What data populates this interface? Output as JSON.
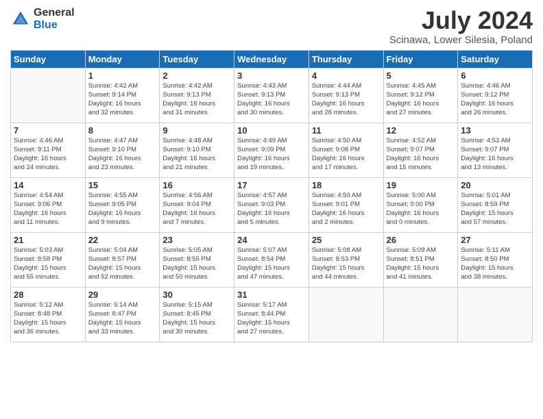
{
  "logo": {
    "general": "General",
    "blue": "Blue"
  },
  "title": "July 2024",
  "subtitle": "Scinawa, Lower Silesia, Poland",
  "days_of_week": [
    "Sunday",
    "Monday",
    "Tuesday",
    "Wednesday",
    "Thursday",
    "Friday",
    "Saturday"
  ],
  "weeks": [
    [
      {
        "day": "",
        "info": ""
      },
      {
        "day": "1",
        "info": "Sunrise: 4:42 AM\nSunset: 9:14 PM\nDaylight: 16 hours\nand 32 minutes."
      },
      {
        "day": "2",
        "info": "Sunrise: 4:42 AM\nSunset: 9:13 PM\nDaylight: 16 hours\nand 31 minutes."
      },
      {
        "day": "3",
        "info": "Sunrise: 4:43 AM\nSunset: 9:13 PM\nDaylight: 16 hours\nand 30 minutes."
      },
      {
        "day": "4",
        "info": "Sunrise: 4:44 AM\nSunset: 9:13 PM\nDaylight: 16 hours\nand 28 minutes."
      },
      {
        "day": "5",
        "info": "Sunrise: 4:45 AM\nSunset: 9:12 PM\nDaylight: 16 hours\nand 27 minutes."
      },
      {
        "day": "6",
        "info": "Sunrise: 4:46 AM\nSunset: 9:12 PM\nDaylight: 16 hours\nand 26 minutes."
      }
    ],
    [
      {
        "day": "7",
        "info": "Sunrise: 4:46 AM\nSunset: 9:11 PM\nDaylight: 16 hours\nand 24 minutes."
      },
      {
        "day": "8",
        "info": "Sunrise: 4:47 AM\nSunset: 9:10 PM\nDaylight: 16 hours\nand 23 minutes."
      },
      {
        "day": "9",
        "info": "Sunrise: 4:48 AM\nSunset: 9:10 PM\nDaylight: 16 hours\nand 21 minutes."
      },
      {
        "day": "10",
        "info": "Sunrise: 4:49 AM\nSunset: 9:09 PM\nDaylight: 16 hours\nand 19 minutes."
      },
      {
        "day": "11",
        "info": "Sunrise: 4:50 AM\nSunset: 9:08 PM\nDaylight: 16 hours\nand 17 minutes."
      },
      {
        "day": "12",
        "info": "Sunrise: 4:52 AM\nSunset: 9:07 PM\nDaylight: 16 hours\nand 15 minutes."
      },
      {
        "day": "13",
        "info": "Sunrise: 4:53 AM\nSunset: 9:07 PM\nDaylight: 16 hours\nand 13 minutes."
      }
    ],
    [
      {
        "day": "14",
        "info": "Sunrise: 4:54 AM\nSunset: 9:06 PM\nDaylight: 16 hours\nand 11 minutes."
      },
      {
        "day": "15",
        "info": "Sunrise: 4:55 AM\nSunset: 9:05 PM\nDaylight: 16 hours\nand 9 minutes."
      },
      {
        "day": "16",
        "info": "Sunrise: 4:56 AM\nSunset: 9:04 PM\nDaylight: 16 hours\nand 7 minutes."
      },
      {
        "day": "17",
        "info": "Sunrise: 4:57 AM\nSunset: 9:03 PM\nDaylight: 16 hours\nand 5 minutes."
      },
      {
        "day": "18",
        "info": "Sunrise: 4:59 AM\nSunset: 9:01 PM\nDaylight: 16 hours\nand 2 minutes."
      },
      {
        "day": "19",
        "info": "Sunrise: 5:00 AM\nSunset: 9:00 PM\nDaylight: 16 hours\nand 0 minutes."
      },
      {
        "day": "20",
        "info": "Sunrise: 5:01 AM\nSunset: 8:59 PM\nDaylight: 15 hours\nand 57 minutes."
      }
    ],
    [
      {
        "day": "21",
        "info": "Sunrise: 5:03 AM\nSunset: 8:58 PM\nDaylight: 15 hours\nand 55 minutes."
      },
      {
        "day": "22",
        "info": "Sunrise: 5:04 AM\nSunset: 8:57 PM\nDaylight: 15 hours\nand 52 minutes."
      },
      {
        "day": "23",
        "info": "Sunrise: 5:05 AM\nSunset: 8:55 PM\nDaylight: 15 hours\nand 50 minutes."
      },
      {
        "day": "24",
        "info": "Sunrise: 5:07 AM\nSunset: 8:54 PM\nDaylight: 15 hours\nand 47 minutes."
      },
      {
        "day": "25",
        "info": "Sunrise: 5:08 AM\nSunset: 8:53 PM\nDaylight: 15 hours\nand 44 minutes."
      },
      {
        "day": "26",
        "info": "Sunrise: 5:09 AM\nSunset: 8:51 PM\nDaylight: 15 hours\nand 41 minutes."
      },
      {
        "day": "27",
        "info": "Sunrise: 5:11 AM\nSunset: 8:50 PM\nDaylight: 15 hours\nand 38 minutes."
      }
    ],
    [
      {
        "day": "28",
        "info": "Sunrise: 5:12 AM\nSunset: 8:48 PM\nDaylight: 15 hours\nand 36 minutes."
      },
      {
        "day": "29",
        "info": "Sunrise: 5:14 AM\nSunset: 8:47 PM\nDaylight: 15 hours\nand 33 minutes."
      },
      {
        "day": "30",
        "info": "Sunrise: 5:15 AM\nSunset: 8:45 PM\nDaylight: 15 hours\nand 30 minutes."
      },
      {
        "day": "31",
        "info": "Sunrise: 5:17 AM\nSunset: 8:44 PM\nDaylight: 15 hours\nand 27 minutes."
      },
      {
        "day": "",
        "info": ""
      },
      {
        "day": "",
        "info": ""
      },
      {
        "day": "",
        "info": ""
      }
    ]
  ]
}
